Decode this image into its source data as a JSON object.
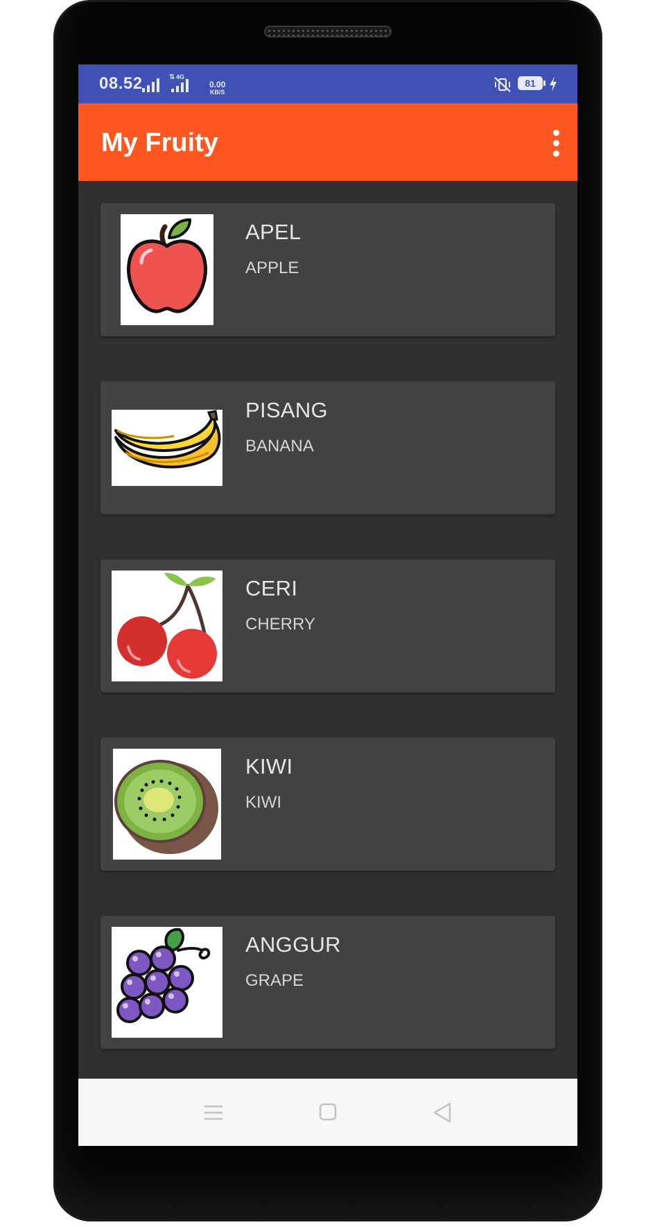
{
  "status_bar": {
    "time": "08.52",
    "network_type": "4G",
    "speed_value": "0.00",
    "speed_unit": "KB/S",
    "battery_level": "81",
    "icons": [
      "signal-icon",
      "data-signal-icon",
      "vibrate-mute-icon",
      "battery-icon",
      "charging-icon"
    ]
  },
  "app_bar": {
    "title": "My Fruity",
    "menu_icon": "more-vert-icon"
  },
  "fruits": [
    {
      "name": "APEL",
      "english": "APPLE",
      "image": "apple"
    },
    {
      "name": "PISANG",
      "english": "BANANA",
      "image": "banana"
    },
    {
      "name": "CERI",
      "english": "CHERRY",
      "image": "cherry"
    },
    {
      "name": "KIWI",
      "english": "KIWI",
      "image": "kiwi"
    },
    {
      "name": "ANGGUR",
      "english": "GRAPE",
      "image": "grape"
    }
  ],
  "nav_bar": {
    "buttons": [
      "menu-icon",
      "home-icon",
      "back-icon"
    ]
  },
  "colors": {
    "status_bar": "#3f51b5",
    "app_bar": "#ff5722",
    "background": "#303030",
    "card": "#424242",
    "nav_bar": "#f7f7f7"
  }
}
